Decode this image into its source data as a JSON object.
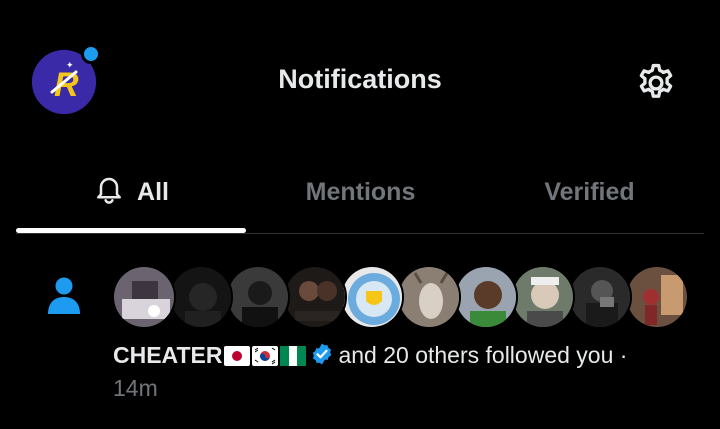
{
  "header": {
    "title": "Notifications",
    "avatar_letter": "R",
    "accent_color": "#1d9bf0"
  },
  "tabs": [
    {
      "label": "All",
      "active": true,
      "icon": "bell-icon"
    },
    {
      "label": "Mentions",
      "active": false
    },
    {
      "label": "Verified",
      "active": false
    }
  ],
  "notification": {
    "type_icon": "person-icon",
    "avatar_count": 10,
    "name": "CHEATER",
    "name_flags": [
      "japan-flag",
      "south-korea-flag",
      "nigeria-flag"
    ],
    "verified": true,
    "message": "and 20 others followed you ·",
    "time": "14m"
  }
}
